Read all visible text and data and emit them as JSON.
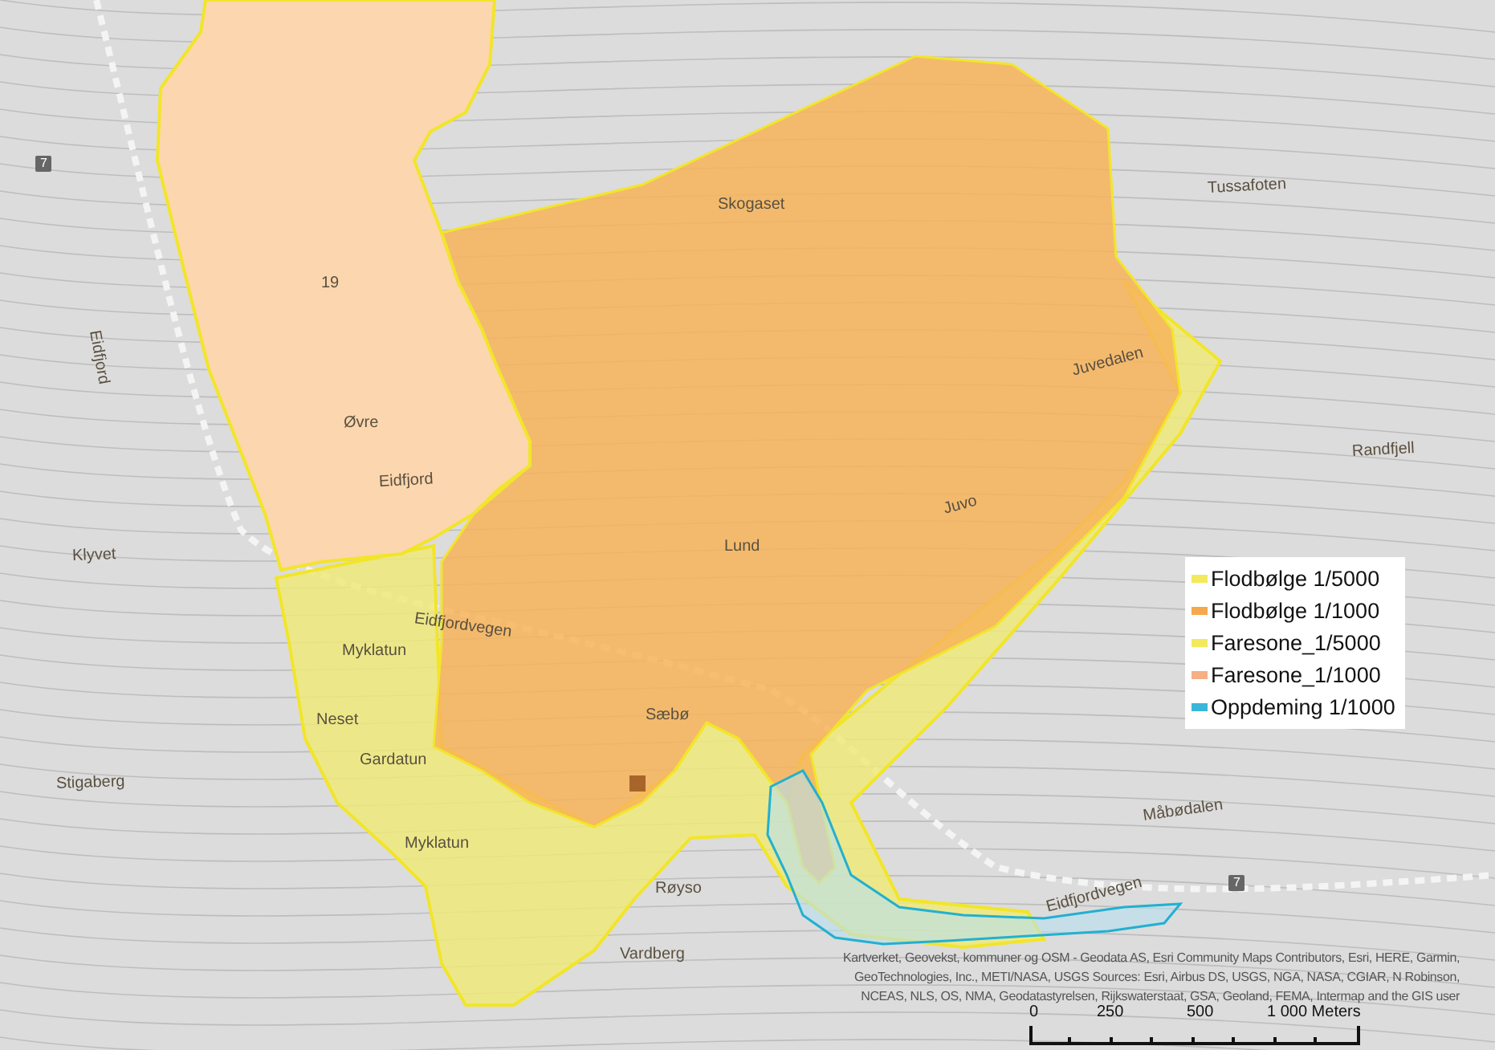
{
  "map": {
    "labels": [
      {
        "text": "Skogaset"
      },
      {
        "text": "Tussafoten"
      },
      {
        "text": "19"
      },
      {
        "text": "Juvedalen"
      },
      {
        "text": "Øvre"
      },
      {
        "text": "Randfjell"
      },
      {
        "text": "Eidfjord"
      },
      {
        "text": "Eidfjord"
      },
      {
        "text": "Juvo"
      },
      {
        "text": "Lund"
      },
      {
        "text": "Klyvet"
      },
      {
        "text": "Eidfjordvegen"
      },
      {
        "text": "Myklatun"
      },
      {
        "text": "Neset"
      },
      {
        "text": "Gardatun"
      },
      {
        "text": "Sæbø"
      },
      {
        "text": "Stigaberg"
      },
      {
        "text": "Myklatun"
      },
      {
        "text": "Måbødalen"
      },
      {
        "text": "Røyso"
      },
      {
        "text": "Eidfjordvegen"
      },
      {
        "text": "Vardberg"
      }
    ],
    "road_shields": [
      {
        "text": "7"
      },
      {
        "text": "7"
      }
    ]
  },
  "legend": {
    "items": [
      {
        "label": "Flodbølge 1/5000",
        "color": "#f2ea5c"
      },
      {
        "label": "Flodbølge 1/1000",
        "color": "#f5a84e"
      },
      {
        "label": "Faresone_1/5000",
        "color": "#f2ea5c"
      },
      {
        "label": "Faresone_1/1000",
        "color": "#f5b084"
      },
      {
        "label": "Oppdeming 1/1000",
        "color": "#3bb5d8"
      }
    ]
  },
  "attribution": {
    "lines": [
      "Kartverket, Geovekst, kommuner og OSM - Geodata AS, Esri Community Maps Contributors, Esri, HERE, Garmin,",
      "GeoTechnologies, Inc., METI/NASA, USGS Sources: Esri, Airbus DS, USGS, NGA, NASA, CGIAR, N Robinson,",
      "NCEAS, NLS, OS, NMA, Geodatastyrelsen, Rijkswaterstaat, GSA, Geoland, FEMA, Intermap and the GIS user"
    ]
  },
  "scale_bar": {
    "ticks": [
      "0",
      "250",
      "500",
      "1 000 Meters"
    ]
  }
}
